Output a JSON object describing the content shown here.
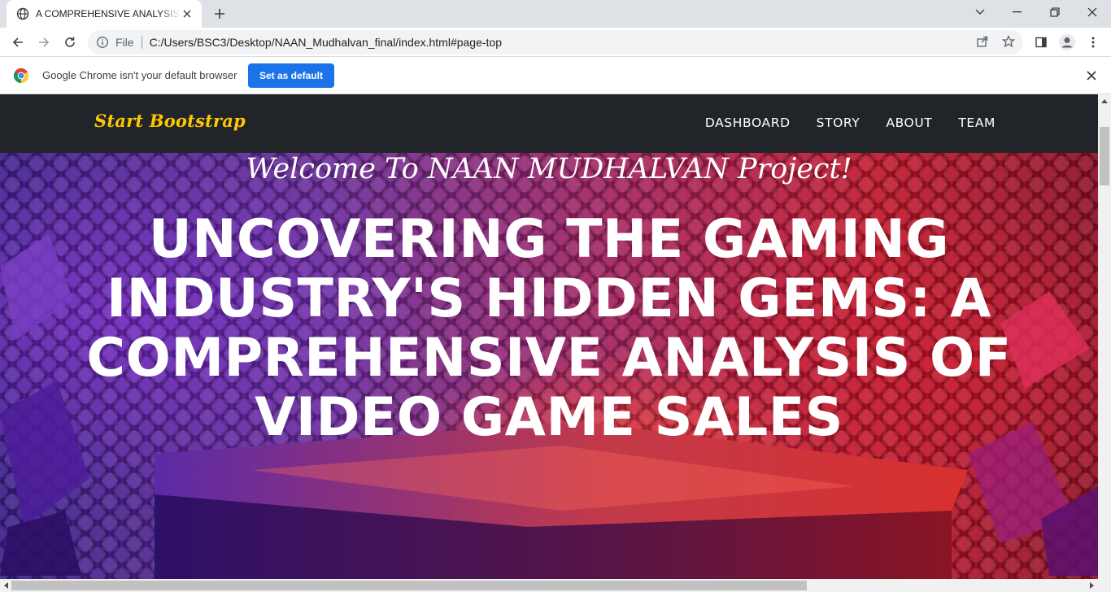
{
  "browser": {
    "tab_title": "A COMPREHENSIVE ANALYSIS OF VIDEO GAME SALES",
    "address_scheme": "File",
    "address_url": "C:/Users/BSC3/Desktop/NAAN_Mudhalvan_final/index.html#page-top"
  },
  "infobar": {
    "message": "Google Chrome isn't your default browser",
    "button_label": "Set as default"
  },
  "site": {
    "brand": "Start Bootstrap",
    "nav": [
      "DASHBOARD",
      "STORY",
      "ABOUT",
      "TEAM"
    ],
    "welcome": "Welcome To NAAN MUDHALVAN Project!",
    "headline": "UNCOVERING THE GAMING INDUSTRY'S HIDDEN GEMS: A COMPREHENSIVE ANALYSIS OF VIDEO GAME SALES"
  },
  "colors": {
    "brand": "#ffc800",
    "navbar": "#212529",
    "accent_button": "#1a73e8"
  }
}
